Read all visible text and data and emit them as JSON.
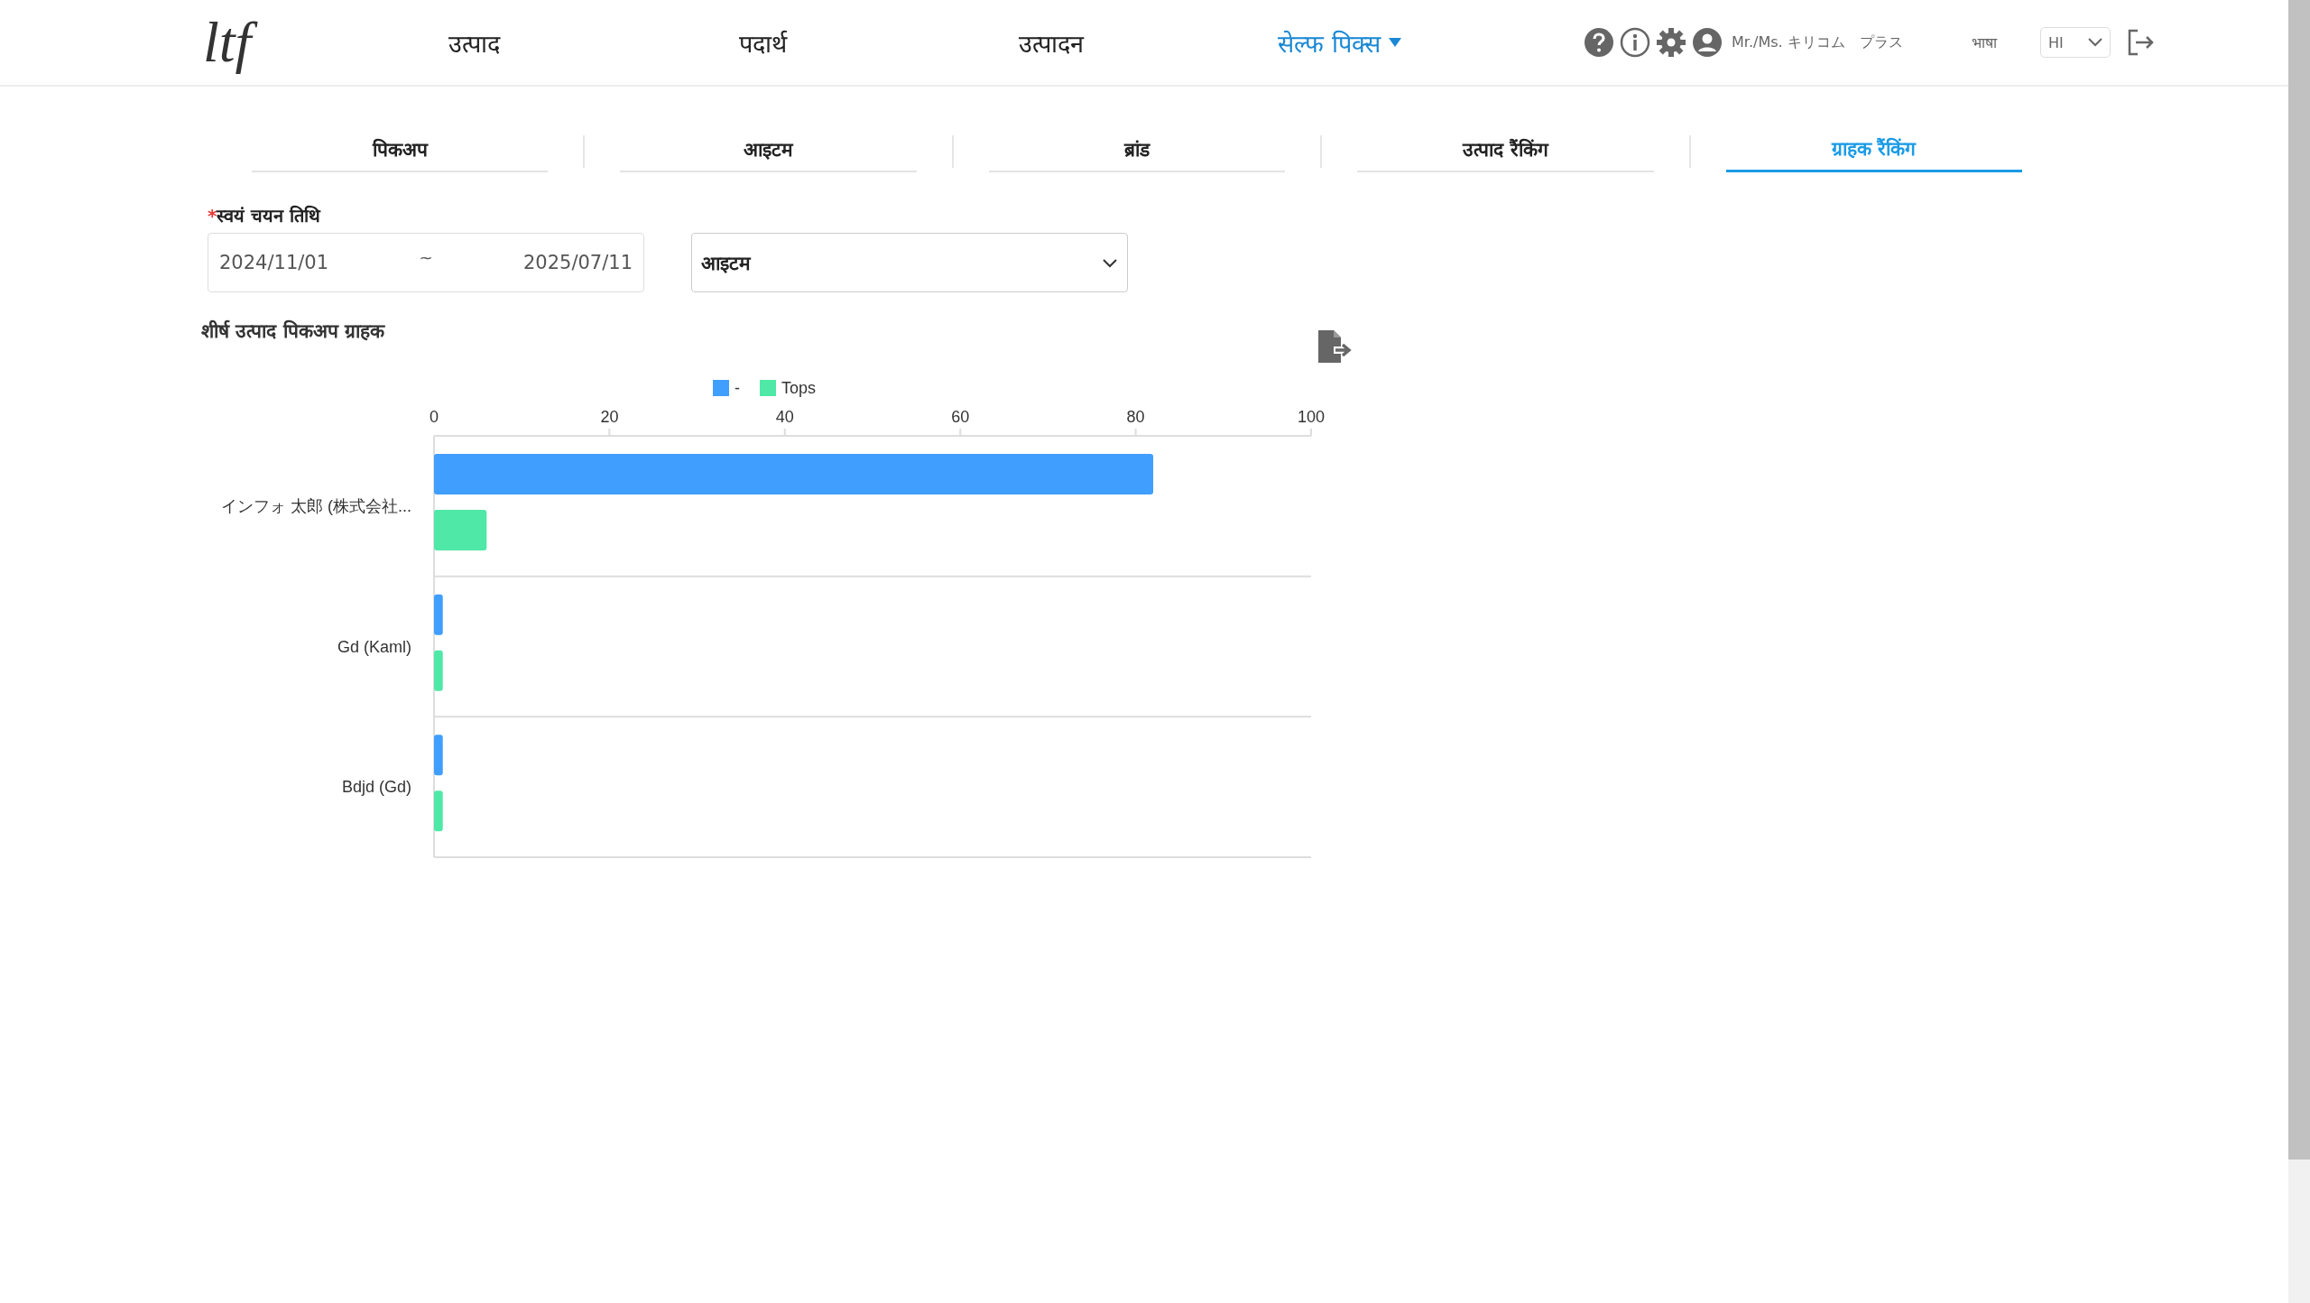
{
  "header": {
    "logo": "ltf",
    "nav": [
      {
        "label": "उत्पाद",
        "selected": false,
        "dropdown": false
      },
      {
        "label": "पदार्थ",
        "selected": false,
        "dropdown": false
      },
      {
        "label": "उत्पादन",
        "selected": false,
        "dropdown": false
      },
      {
        "label": "सेल्फ पिक्स",
        "selected": true,
        "dropdown": true
      }
    ],
    "user_name": "Mr./Ms. キリコム　プラス",
    "language_label": "भाषा",
    "language": "HI"
  },
  "tabs": [
    {
      "label": "पिकअप",
      "selected": false
    },
    {
      "label": "आइटम",
      "selected": false
    },
    {
      "label": "ब्रांड",
      "selected": false
    },
    {
      "label": "उत्पाद रैंकिंग",
      "selected": false
    },
    {
      "label": "ग्राहक रैंकिंग",
      "selected": true
    }
  ],
  "filters": {
    "date_label": "स्वयं चयन तिथि",
    "required_mark": "*",
    "date_from": "2024/11/01",
    "separator": "~",
    "date_to": "2025/07/11",
    "category": "आइटम"
  },
  "chart": {
    "title": "शीर्ष उत्पाद पिकअप ग्राहक",
    "chart_data": {
      "type": "bar",
      "orientation": "horizontal",
      "categories": [
        "インフォ 太郎 (株式会社...",
        "Gd (Kaml)",
        "Bdjd (Gd)"
      ],
      "series": [
        {
          "name": "-",
          "color": "#409eff",
          "values": [
            82,
            1,
            1
          ]
        },
        {
          "name": "Tops",
          "color": "#4fe8a6",
          "values": [
            6,
            1,
            1
          ]
        }
      ],
      "legend": "top",
      "xlim": [
        0,
        100
      ],
      "xticks": [
        0,
        20,
        40,
        60,
        80,
        100
      ]
    }
  }
}
